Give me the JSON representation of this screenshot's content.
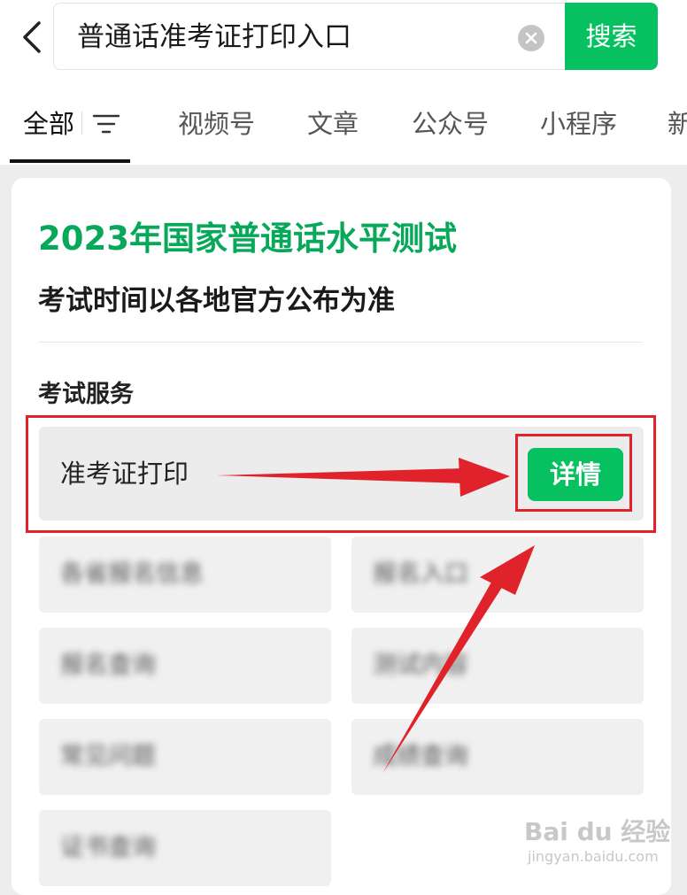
{
  "search": {
    "query": "普通话准考证打印入口",
    "button_label": "搜索"
  },
  "tabs": [
    {
      "label": "全部",
      "active": true
    },
    {
      "label": "视频号",
      "active": false
    },
    {
      "label": "文章",
      "active": false
    },
    {
      "label": "公众号",
      "active": false
    },
    {
      "label": "小程序",
      "active": false
    },
    {
      "label": "新",
      "active": false
    }
  ],
  "card": {
    "title": "2023年国家普通话水平测试",
    "subtitle": "考试时间以各地官方公布为准",
    "section_label": "考试服务",
    "featured_service": {
      "label": "准考证打印",
      "button_label": "详情"
    },
    "blurred_services": [
      "各省报名信息",
      "报名入口",
      "报名查询",
      "测试内容",
      "常见问题",
      "成绩查询",
      "证书查询"
    ]
  },
  "colors": {
    "accent": "#07c160",
    "title_green": "#07a85a",
    "annotation_red": "#e0232b"
  },
  "watermark": {
    "brand": "Bai du 经验",
    "url": "jingyan.baidu.com"
  }
}
